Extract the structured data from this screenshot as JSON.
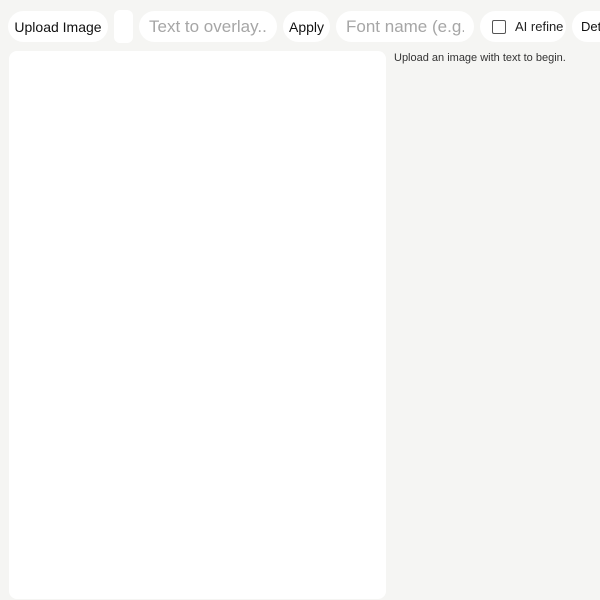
{
  "toolbar": {
    "upload_label": "Upload Image",
    "overlay_placeholder": "Text to overlay...",
    "apply_label": "Apply",
    "font_placeholder": "Font name (e.g. Montserrat)",
    "ai_refine_label": "AI refine",
    "ai_refine_checked": false,
    "detect_label": "Detect"
  },
  "status": {
    "message": "Upload an image with text to begin."
  },
  "colors": {
    "page_background": "#f5f5f3",
    "panel_background": "#ffffff",
    "placeholder_text": "#a6a6a6"
  }
}
